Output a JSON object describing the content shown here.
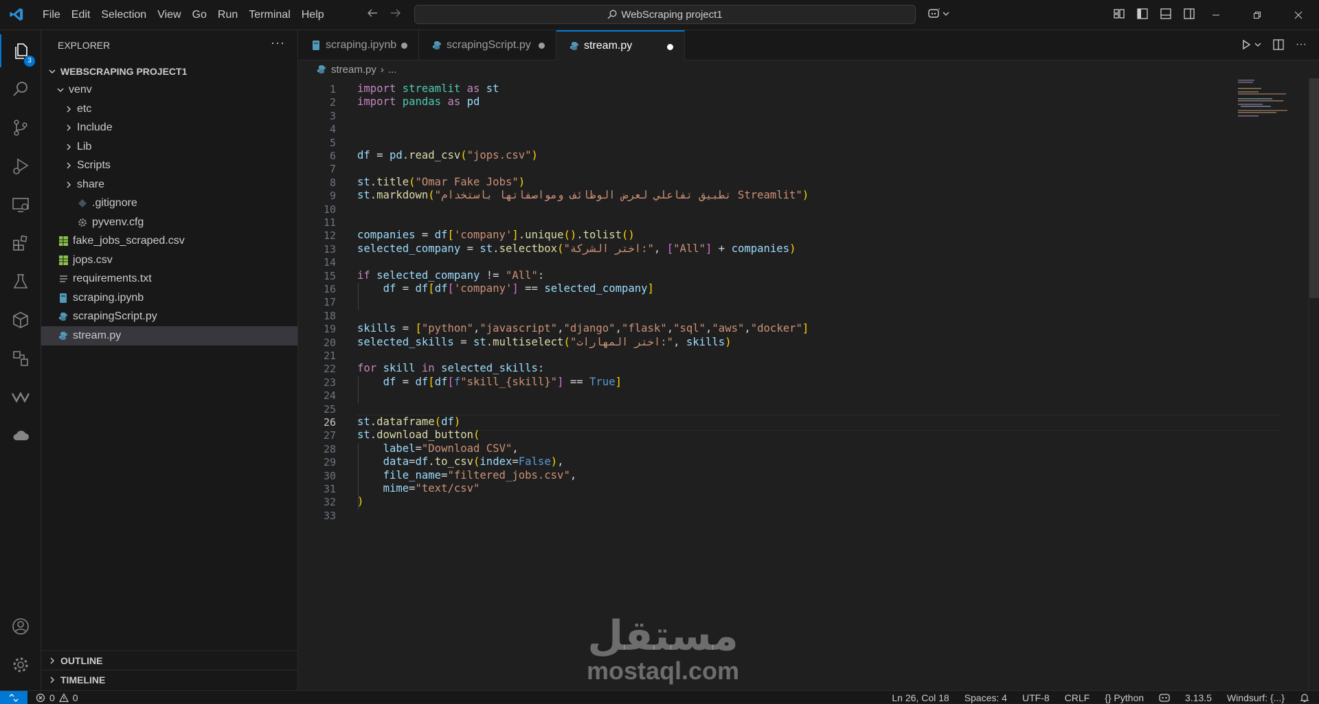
{
  "titlebar": {
    "menu": [
      "File",
      "Edit",
      "Selection",
      "View",
      "Go",
      "Run",
      "Terminal",
      "Help"
    ],
    "search": "WebScraping project1"
  },
  "activity": {
    "explorer_badge": "3"
  },
  "sidebar": {
    "title": "EXPLORER",
    "more": "···",
    "project": "WEBSCRAPING PROJECT1",
    "items": [
      {
        "label": "venv"
      },
      {
        "label": "etc"
      },
      {
        "label": "Include"
      },
      {
        "label": "Lib"
      },
      {
        "label": "Scripts"
      },
      {
        "label": "share"
      },
      {
        "label": ".gitignore"
      },
      {
        "label": "pyvenv.cfg"
      },
      {
        "label": "fake_jobs_scraped.csv"
      },
      {
        "label": "jops.csv"
      },
      {
        "label": "requirements.txt"
      },
      {
        "label": "scraping.ipynb"
      },
      {
        "label": "scrapingScript.py"
      },
      {
        "label": "stream.py"
      }
    ],
    "outline": "OUTLINE",
    "timeline": "TIMELINE"
  },
  "tabs": [
    {
      "label": "scraping.ipynb"
    },
    {
      "label": "scrapingScript.py"
    },
    {
      "label": "stream.py"
    }
  ],
  "breadcrumb": {
    "file": "stream.py",
    "rest": "..."
  },
  "editor": {
    "line_numbers": [
      "1",
      "2",
      "3",
      "4",
      "5",
      "6",
      "7",
      "8",
      "9",
      "10",
      "11",
      "12",
      "13",
      "14",
      "15",
      "16",
      "17",
      "18",
      "19",
      "20",
      "21",
      "22",
      "23",
      "24",
      "25",
      "26",
      "27",
      "28",
      "29",
      "30",
      "31",
      "32",
      "33"
    ],
    "lines": [
      "import streamlit as st",
      "import pandas as pd",
      "",
      "",
      "",
      "df = pd.read_csv(\"jops.csv\")",
      "",
      "st.title(\"Omar Fake Jobs\")",
      "st.markdown(\"تطبيق تفاعلي لعرض الوظائف ومواصفاتها باستخدام Streamlit\")",
      "",
      "",
      "companies = df['company'].unique().tolist()",
      "selected_company = st.selectbox(\"اختر الشركة:\", [\"All\"] + companies)",
      "",
      "if selected_company != \"All\":",
      "    df = df[df['company'] == selected_company]",
      "",
      "",
      "skills = [\"python\",\"javascript\",\"django\",\"flask\",\"sql\",\"aws\",\"docker\"]",
      "selected_skills = st.multiselect(\"اختر المهارات:\", skills)",
      "",
      "for skill in selected_skills:",
      "    df = df[df[f\"skill_{skill}\"] == True]",
      "",
      "",
      "st.dataframe(df)",
      "st.download_button(",
      "    label=\"Download CSV\",",
      "    data=df.to_csv(index=False),",
      "    file_name=\"filtered_jobs.csv\",",
      "    mime=\"text/csv\"",
      ")",
      ""
    ]
  },
  "watermark": {
    "arabic": "مستقل",
    "latin": "mostaql.com"
  },
  "statusbar": {
    "errors": "0",
    "warnings": "0",
    "position": "Ln 26, Col 18",
    "spaces": "Spaces: 4",
    "encoding": "UTF-8",
    "eol": "CRLF",
    "language": "{} Python",
    "version": "3.13.5",
    "windsurf": "Windsurf: {...}"
  }
}
